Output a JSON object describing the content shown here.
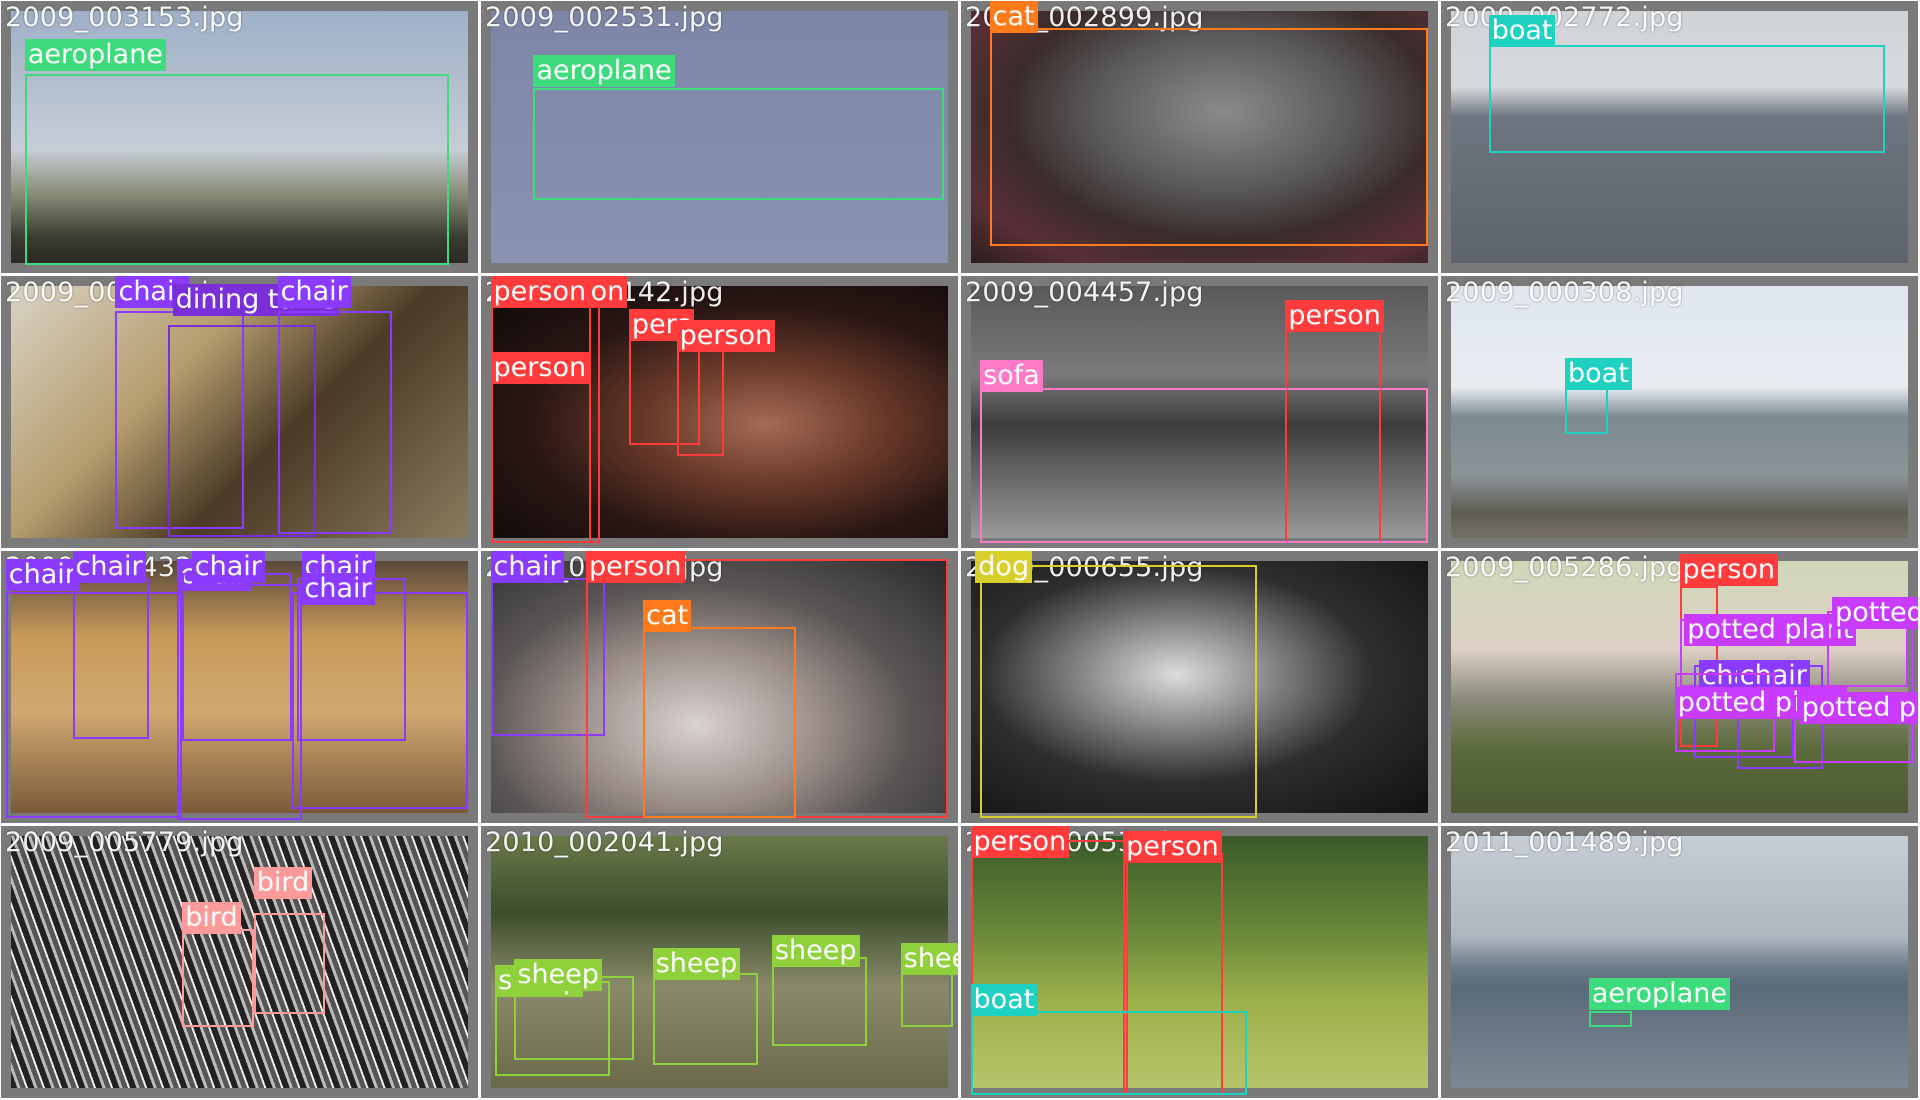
{
  "colors": {
    "aeroplane": "#3ddb7c",
    "boat": "#1fd1c0",
    "cat": "#ff7a1a",
    "person": "#ff3b3b",
    "chair": "#8a3bff",
    "dining table": "#7b2fd8",
    "sofa": "#ff7ac6",
    "dog": "#d8cf2a",
    "potted plant": "#c83bff",
    "bird": "#ff9a9a",
    "sheep": "#8fd13a"
  },
  "tiles": [
    {
      "file": "2009_003153.jpg",
      "labels": [
        {
          "text": "aeroplane",
          "cls": "aeroplane"
        }
      ]
    },
    {
      "file": "2009_002531.jpg",
      "labels": [
        {
          "text": "aeroplane",
          "cls": "aeroplane"
        }
      ]
    },
    {
      "file": "2009_002899.jpg",
      "labels": [
        {
          "text": "cat",
          "cls": "cat"
        }
      ]
    },
    {
      "file": "2009_002772.jpg",
      "labels": [
        {
          "text": "boat",
          "cls": "boat"
        }
      ]
    },
    {
      "file": "2009_003075.jpg",
      "labels": [
        {
          "text": "chair",
          "cls": "chair"
        },
        {
          "text": "dining table",
          "cls": "dining table"
        },
        {
          "text": "chair",
          "cls": "chair"
        }
      ]
    },
    {
      "file": "2009_004142.jpg",
      "labels": [
        {
          "text": "person",
          "cls": "person"
        },
        {
          "text": "person",
          "cls": "person"
        },
        {
          "text": "person",
          "cls": "person"
        },
        {
          "text": "pers",
          "cls": "person"
        },
        {
          "text": "person",
          "cls": "person"
        }
      ]
    },
    {
      "file": "2009_004457.jpg",
      "labels": [
        {
          "text": "person",
          "cls": "person"
        },
        {
          "text": "sofa",
          "cls": "sofa"
        }
      ]
    },
    {
      "file": "2009_000308.jpg",
      "labels": [
        {
          "text": "boat",
          "cls": "boat"
        }
      ]
    },
    {
      "file": "2009_004432.jpg",
      "labels": [
        {
          "text": "chair",
          "cls": "chair"
        },
        {
          "text": "chair",
          "cls": "chair"
        },
        {
          "text": "chair",
          "cls": "chair"
        },
        {
          "text": "chair",
          "cls": "chair"
        },
        {
          "text": "chair",
          "cls": "chair"
        },
        {
          "text": "chair",
          "cls": "chair"
        }
      ]
    },
    {
      "file": "2009_001388.jpg",
      "labels": [
        {
          "text": "chair",
          "cls": "chair"
        },
        {
          "text": "person",
          "cls": "person"
        },
        {
          "text": "cat",
          "cls": "cat"
        }
      ]
    },
    {
      "file": "2010_000655.jpg",
      "labels": [
        {
          "text": "dog",
          "cls": "dog"
        }
      ]
    },
    {
      "file": "2009_005286.jpg",
      "labels": [
        {
          "text": "person",
          "cls": "person"
        },
        {
          "text": "potted plant",
          "cls": "potted plant"
        },
        {
          "text": "potted pl",
          "cls": "potted plant"
        },
        {
          "text": "chair",
          "cls": "chair"
        },
        {
          "text": "chair",
          "cls": "chair"
        },
        {
          "text": "potted plant",
          "cls": "potted plant"
        },
        {
          "text": "potted pla",
          "cls": "potted plant"
        }
      ]
    },
    {
      "file": "2009_005779.jpg",
      "labels": [
        {
          "text": "bird",
          "cls": "bird"
        },
        {
          "text": "bird",
          "cls": "bird"
        }
      ]
    },
    {
      "file": "2010_002041.jpg",
      "labels": [
        {
          "text": "sheep",
          "cls": "sheep"
        },
        {
          "text": "sheep",
          "cls": "sheep"
        },
        {
          "text": "sheep",
          "cls": "sheep"
        },
        {
          "text": "sheep",
          "cls": "sheep"
        },
        {
          "text": "sheep",
          "cls": "sheep"
        }
      ]
    },
    {
      "file": "2010_000535.jpg",
      "labels": [
        {
          "text": "person",
          "cls": "person"
        },
        {
          "text": "person",
          "cls": "person"
        },
        {
          "text": "boat",
          "cls": "boat"
        }
      ]
    },
    {
      "file": "2011_001489.jpg",
      "labels": [
        {
          "text": "aeroplane",
          "cls": "aeroplane"
        }
      ]
    }
  ]
}
